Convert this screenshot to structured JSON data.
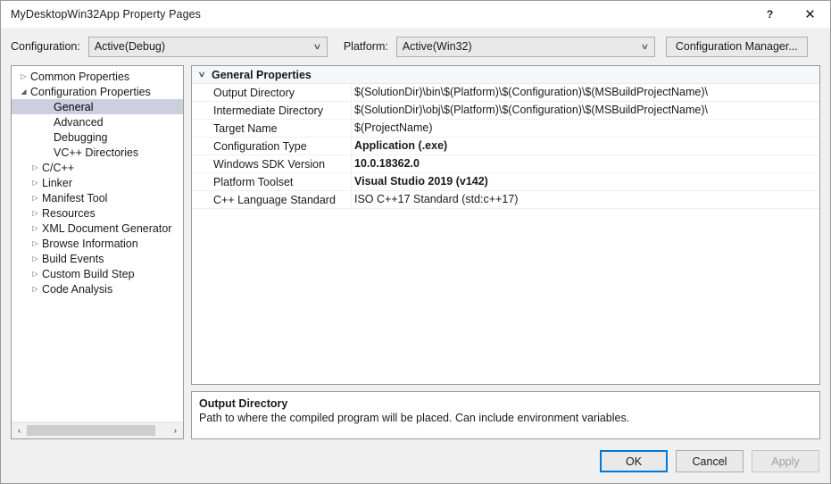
{
  "window": {
    "title": "MyDesktopWin32App Property Pages",
    "help_label": "?",
    "close_label": "✕"
  },
  "configbar": {
    "configuration_label": "Configuration:",
    "configuration_value": "Active(Debug)",
    "platform_label": "Platform:",
    "platform_value": "Active(Win32)",
    "configuration_manager_label": "Configuration Manager...",
    "caret": "∨"
  },
  "tree": {
    "items": [
      {
        "label": "Common Properties",
        "depth": 0,
        "arrow": "▷",
        "selected": false
      },
      {
        "label": "Configuration Properties",
        "depth": 0,
        "arrow": "◢",
        "selected": false
      },
      {
        "label": "General",
        "depth": 2,
        "arrow": "",
        "selected": true
      },
      {
        "label": "Advanced",
        "depth": 2,
        "arrow": "",
        "selected": false
      },
      {
        "label": "Debugging",
        "depth": 2,
        "arrow": "",
        "selected": false
      },
      {
        "label": "VC++ Directories",
        "depth": 2,
        "arrow": "",
        "selected": false
      },
      {
        "label": "C/C++",
        "depth": 1,
        "arrow": "▷",
        "selected": false
      },
      {
        "label": "Linker",
        "depth": 1,
        "arrow": "▷",
        "selected": false
      },
      {
        "label": "Manifest Tool",
        "depth": 1,
        "arrow": "▷",
        "selected": false
      },
      {
        "label": "Resources",
        "depth": 1,
        "arrow": "▷",
        "selected": false
      },
      {
        "label": "XML Document Generator",
        "depth": 1,
        "arrow": "▷",
        "selected": false
      },
      {
        "label": "Browse Information",
        "depth": 1,
        "arrow": "▷",
        "selected": false
      },
      {
        "label": "Build Events",
        "depth": 1,
        "arrow": "▷",
        "selected": false
      },
      {
        "label": "Custom Build Step",
        "depth": 1,
        "arrow": "▷",
        "selected": false
      },
      {
        "label": "Code Analysis",
        "depth": 1,
        "arrow": "▷",
        "selected": false
      }
    ],
    "scrollbar": {
      "left_arrow": "‹",
      "right_arrow": "›"
    }
  },
  "grid": {
    "category": {
      "label": "General Properties",
      "chevron": "∨"
    },
    "rows": [
      {
        "name": "Output Directory",
        "value": "$(SolutionDir)\\bin\\$(Platform)\\$(Configuration)\\$(MSBuildProjectName)\\",
        "bold": false
      },
      {
        "name": "Intermediate Directory",
        "value": "$(SolutionDir)\\obj\\$(Platform)\\$(Configuration)\\$(MSBuildProjectName)\\",
        "bold": false
      },
      {
        "name": "Target Name",
        "value": "$(ProjectName)",
        "bold": false
      },
      {
        "name": "Configuration Type",
        "value": "Application (.exe)",
        "bold": true
      },
      {
        "name": "Windows SDK Version",
        "value": "10.0.18362.0",
        "bold": true
      },
      {
        "name": "Platform Toolset",
        "value": "Visual Studio 2019 (v142)",
        "bold": true
      },
      {
        "name": "C++ Language Standard",
        "value": "ISO C++17 Standard (std:c++17)",
        "bold": false
      }
    ]
  },
  "description": {
    "title": "Output Directory",
    "text": "Path to where the compiled program will be placed. Can include environment variables."
  },
  "footer": {
    "ok_label": "OK",
    "cancel_label": "Cancel",
    "apply_label": "Apply"
  },
  "colors": {
    "accent": "#0078d7",
    "selection": "#ccd0de",
    "category_band": "#f5f7fb",
    "dialog_bg": "#f0f0f0"
  }
}
